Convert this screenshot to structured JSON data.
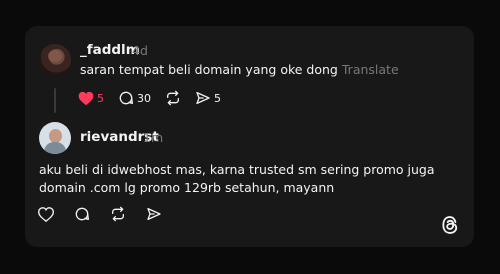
{
  "post": {
    "username": "_faddlm",
    "time": "4d",
    "text": "saran tempat beli domain yang oke dong",
    "translate_label": "Translate",
    "likes": "5",
    "replies": "30",
    "shares": "5",
    "liked": true,
    "like_color": "#ff3b5c"
  },
  "reply": {
    "username": "rievandrst",
    "time": "1m",
    "text_line1": "aku beli di idwebhost mas, karna trusted sm sering promo juga",
    "text_line2": "domain .com lg promo 129rb setahun, mayann"
  },
  "icons": {
    "like": "heart-icon",
    "reply": "comment-bubble-icon",
    "repost": "repost-icon",
    "share": "send-icon",
    "brand": "threads-logo-icon"
  }
}
